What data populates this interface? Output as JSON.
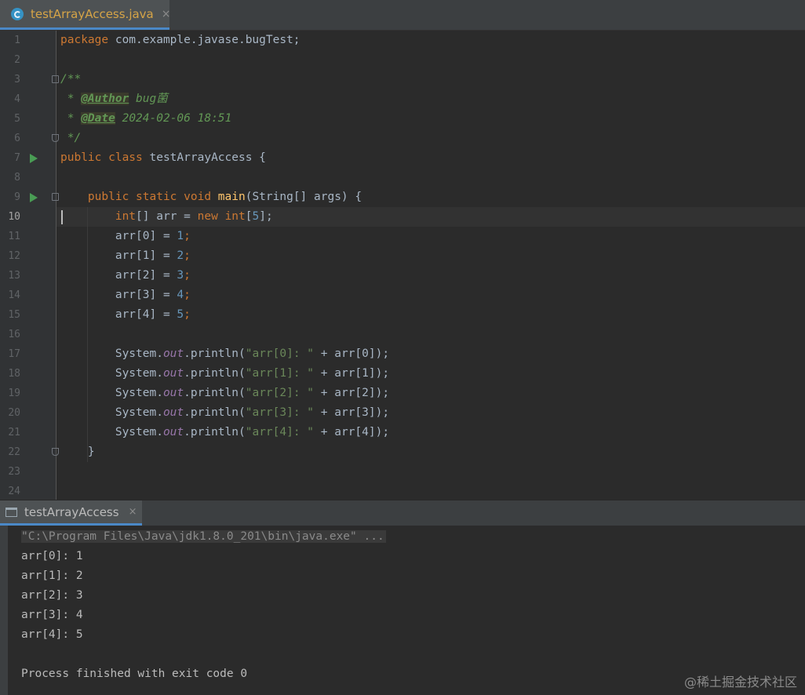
{
  "editor_tab": {
    "title": "testArrayAccess.java",
    "close_glyph": "×",
    "icon": "java-class-icon"
  },
  "editor": {
    "current_line": 10,
    "lines": [
      {
        "n": "1"
      },
      {
        "n": "2"
      },
      {
        "n": "3"
      },
      {
        "n": "4"
      },
      {
        "n": "5"
      },
      {
        "n": "6"
      },
      {
        "n": "7"
      },
      {
        "n": "8"
      },
      {
        "n": "9"
      },
      {
        "n": "10"
      },
      {
        "n": "11"
      },
      {
        "n": "12"
      },
      {
        "n": "13"
      },
      {
        "n": "14"
      },
      {
        "n": "15"
      },
      {
        "n": "16"
      },
      {
        "n": "17"
      },
      {
        "n": "18"
      },
      {
        "n": "19"
      },
      {
        "n": "20"
      },
      {
        "n": "21"
      },
      {
        "n": "22"
      },
      {
        "n": "23"
      },
      {
        "n": "24"
      }
    ],
    "code": {
      "l1_kw": "package",
      "l1_rest": " com.example.javase.bugTest;",
      "l3": "/**",
      "l4_star": " * ",
      "l4_tag": "@Author",
      "l4_val": " bug菌",
      "l5_star": " * ",
      "l5_tag": "@Date",
      "l5_val": " 2024-02-06 18:51",
      "l6": " */",
      "l7_kw": "public class",
      "l7_rest": " testArrayAccess {",
      "l9_kw": "public static void",
      "l9_fn": "main",
      "l9_rest": "(String[] args) {",
      "l10_kw1": "int",
      "l10_a": "[] arr = ",
      "l10_kw2": "new",
      "l10_kw3": "int",
      "l10_b": "[",
      "l10_num": "5",
      "l10_c": "];",
      "assign": [
        {
          "lhs": "arr[0] = ",
          "num": "1",
          "end": ";"
        },
        {
          "lhs": "arr[1] = ",
          "num": "2",
          "end": ";"
        },
        {
          "lhs": "arr[2] = ",
          "num": "3",
          "end": ";"
        },
        {
          "lhs": "arr[3] = ",
          "num": "4",
          "end": ";"
        },
        {
          "lhs": "arr[4] = ",
          "num": "5",
          "end": ";"
        }
      ],
      "prints": [
        {
          "sys": "System.",
          "out": "out",
          "call": ".println(",
          "str": "\"arr[0]: \"",
          "rest": " + arr[0]);"
        },
        {
          "sys": "System.",
          "out": "out",
          "call": ".println(",
          "str": "\"arr[1]: \"",
          "rest": " + arr[1]);"
        },
        {
          "sys": "System.",
          "out": "out",
          "call": ".println(",
          "str": "\"arr[2]: \"",
          "rest": " + arr[2]);"
        },
        {
          "sys": "System.",
          "out": "out",
          "call": ".println(",
          "str": "\"arr[3]: \"",
          "rest": " + arr[3]);"
        },
        {
          "sys": "System.",
          "out": "out",
          "call": ".println(",
          "str": "\"arr[4]: \"",
          "rest": " + arr[4]);"
        }
      ],
      "l22": "}"
    }
  },
  "run_panel": {
    "tab_title": "testArrayAccess",
    "close_glyph": "×",
    "icon": "console-icon",
    "command": "\"C:\\Program Files\\Java\\jdk1.8.0_201\\bin\\java.exe\" ...",
    "output": [
      "arr[0]: 1",
      "arr[1]: 2",
      "arr[2]: 3",
      "arr[3]: 4",
      "arr[4]: 5"
    ],
    "exit_message": "Process finished with exit code 0"
  },
  "watermark": "@稀土掘金技术社区",
  "colors": {
    "keyword": "#cc7832",
    "number": "#6897bb",
    "string": "#6a8759",
    "field": "#9876aa",
    "method": "#ffc66d",
    "doc": "#629755",
    "tab_title": "#d6a447"
  }
}
